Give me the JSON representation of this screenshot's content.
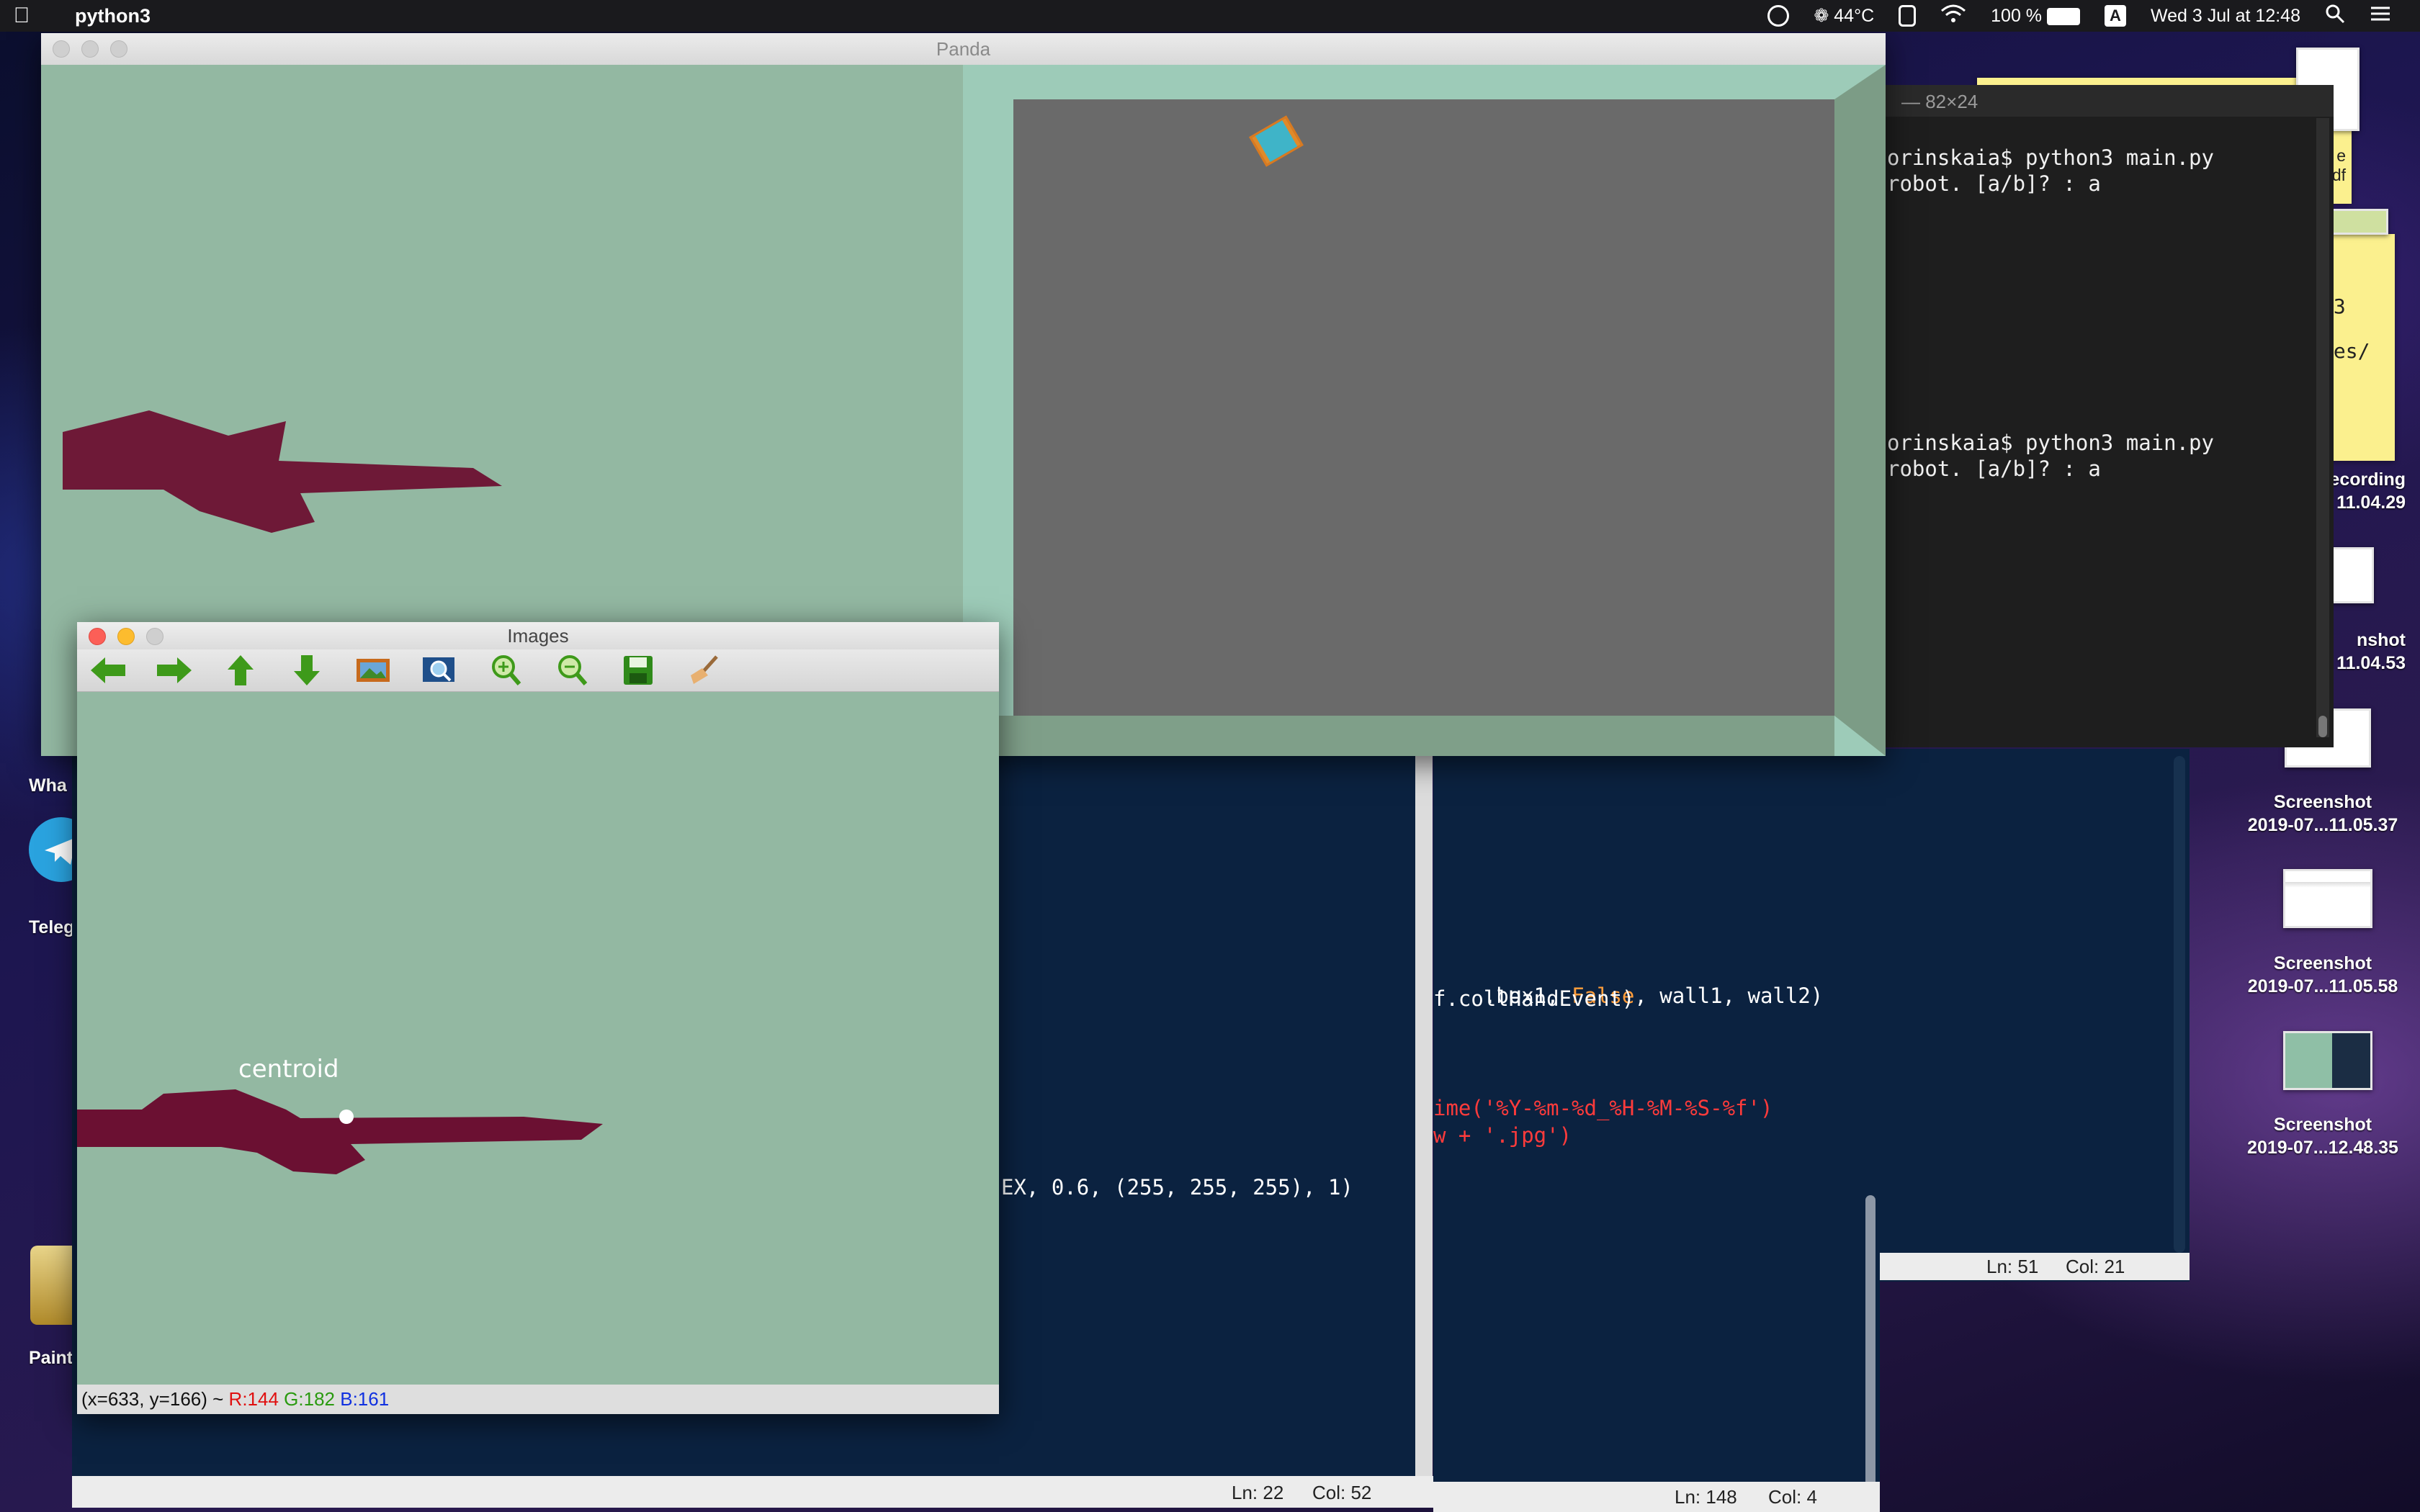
{
  "menubar": {
    "app_name": "python3",
    "temperature": "44°C",
    "battery": "100 %",
    "input_source": "A",
    "datetime": "Wed 3 Jul at 12:48"
  },
  "panda_window": {
    "title": "Panda"
  },
  "images_window": {
    "title": "Images",
    "toolbar": [
      "back-arrow",
      "forward-arrow",
      "up-arrow",
      "down-arrow",
      "image",
      "zoom-fit",
      "zoom-in",
      "zoom-out",
      "save",
      "clear-brush"
    ],
    "overlay_label": "centroid",
    "status": {
      "coords": "(x=633, y=166) ~",
      "r": "R:144",
      "g": "G:182",
      "b": "B:161"
    }
  },
  "terminal": {
    "title": "— 82×24",
    "lines": [
      "orinskaia$ python3 main.py",
      "robot. [a/b]? : a",
      "orinskaia$ python3 main.py",
      "robot. [a/b]? : a"
    ]
  },
  "editor_left": {
    "code_line": "EX, 0.6, (255, 255, 255), 1)",
    "status_ln": "Ln: 22",
    "status_col": "Col: 52"
  },
  "editor_right": {
    "line1_a": ".box1, ",
    "line1_kw": "False",
    "line1_b": ", wall1, wall2)",
    "line2": "f.collHandEvent)",
    "line3": "ime('%Y-%m-%d_%H-%M-%S-%f')",
    "line4": "w + '.jpg')",
    "status_ln": "Ln: 148",
    "status_col": "Col: 4"
  },
  "editor_back": {
    "status_ln": "Ln: 51",
    "status_col": "Col: 21"
  },
  "sticky_notes": {
    "note1_text": "e\ndf",
    "note2_text": "/3\nles/\ng"
  },
  "desktop": {
    "left_labels": [
      "Wha",
      "Teleg",
      "Paint"
    ],
    "items": [
      {
        "line1": "ecording",
        "line2": "11.04.29"
      },
      {
        "line1": "nshot",
        "line2": "11.04.53"
      },
      {
        "line1": "Screenshot",
        "line2": "2019-07...11.05.37"
      },
      {
        "line1": "Screenshot",
        "line2": "2019-07...11.05.58"
      },
      {
        "line1": "Screenshot",
        "line2": "2019-07...12.48.35"
      }
    ]
  },
  "colors": {
    "desktop_accent": "#1d1650",
    "sim_floor": "#6a6a6a",
    "sim_wall": "#9dcbb8",
    "sim_ground": "#93b8a2",
    "target_shape": "#6b1032",
    "editor_bg": "#0b2240",
    "keyword": "#ff9d3b",
    "string": "#ff3b3b"
  }
}
